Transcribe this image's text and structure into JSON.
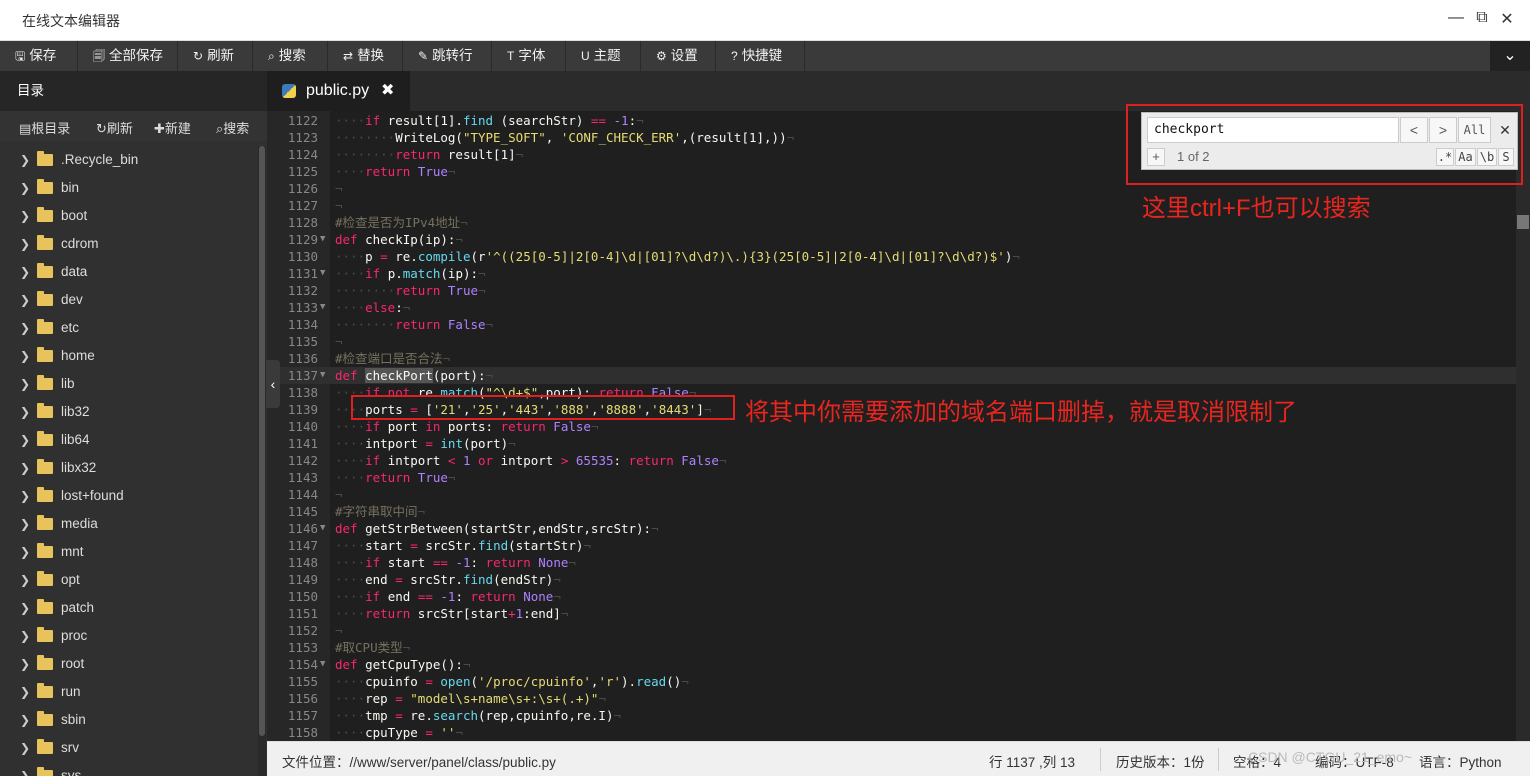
{
  "window": {
    "title": "在线文本编辑器"
  },
  "toolbar": [
    {
      "icon": "save-icon",
      "glyph": "🖫",
      "label": "保存"
    },
    {
      "icon": "save-all-icon",
      "glyph": "🗐",
      "label": "全部保存"
    },
    {
      "icon": "refresh-icon",
      "glyph": "↻",
      "label": "刷新"
    },
    {
      "icon": "search-icon",
      "glyph": "⌕",
      "label": "搜索"
    },
    {
      "icon": "replace-icon",
      "glyph": "⇄",
      "label": "替换"
    },
    {
      "icon": "goto-line-icon",
      "glyph": "✎",
      "label": "跳转行"
    },
    {
      "icon": "font-icon",
      "glyph": "T",
      "label": "字体"
    },
    {
      "icon": "theme-icon",
      "glyph": "U",
      "label": "主题"
    },
    {
      "icon": "settings-icon",
      "glyph": "⚙",
      "label": "设置"
    },
    {
      "icon": "shortcuts-icon",
      "glyph": "?",
      "label": "快捷键"
    }
  ],
  "sidebar": {
    "title": "目录",
    "tools": [
      {
        "icon": "root-dir-icon",
        "glyph": "▤",
        "label": "根目录"
      },
      {
        "icon": "refresh-icon",
        "glyph": "↻",
        "label": "刷新"
      },
      {
        "icon": "new-icon",
        "glyph": "✚",
        "label": "新建"
      },
      {
        "icon": "search-icon",
        "glyph": "⌕",
        "label": "搜索"
      }
    ],
    "tree": [
      ".Recycle_bin",
      "bin",
      "boot",
      "cdrom",
      "data",
      "dev",
      "etc",
      "home",
      "lib",
      "lib32",
      "lib64",
      "libx32",
      "lost+found",
      "media",
      "mnt",
      "opt",
      "patch",
      "proc",
      "root",
      "run",
      "sbin",
      "srv",
      "sys"
    ]
  },
  "tab": {
    "label": "public.py",
    "close": "✖"
  },
  "search": {
    "value": "checkport",
    "prev": "<",
    "next": ">",
    "all": "All",
    "close": "✕",
    "add": "+",
    "count": "1 of 2",
    "options": [
      ".*",
      "Aa",
      "\\b",
      "S"
    ]
  },
  "annotations": {
    "search_note": "这里ctrl+F也可以搜索",
    "ports_note": "将其中你需要添加的域名端口删掉，就是取消限制了"
  },
  "code": {
    "active_line": 1137,
    "lines": [
      {
        "n": 1122,
        "fold": false,
        "indent": 1,
        "tokens": [
          [
            "kw",
            "if"
          ],
          [
            "",
            " result[1]."
          ],
          [
            "fn",
            "find"
          ],
          [
            "",
            " (searchStr) "
          ],
          [
            "kw",
            "=="
          ],
          [
            "",
            " "
          ],
          [
            "cst",
            "-1"
          ],
          [
            "",
            ":"
          ]
        ]
      },
      {
        "n": 1123,
        "fold": false,
        "indent": 2,
        "tokens": [
          [
            "",
            "WriteLog("
          ],
          [
            "str",
            "\"TYPE_SOFT\""
          ],
          [
            "",
            ", "
          ],
          [
            "str",
            "'CONF_CHECK_ERR'"
          ],
          [
            "",
            ",(result[1],))"
          ]
        ]
      },
      {
        "n": 1124,
        "fold": false,
        "indent": 2,
        "tokens": [
          [
            "kw",
            "return"
          ],
          [
            "",
            " result[1]"
          ]
        ]
      },
      {
        "n": 1125,
        "fold": false,
        "indent": 1,
        "tokens": [
          [
            "kw",
            "return"
          ],
          [
            "",
            " "
          ],
          [
            "cst",
            "True"
          ]
        ]
      },
      {
        "n": 1126,
        "fold": false,
        "indent": 0,
        "tokens": []
      },
      {
        "n": 1127,
        "fold": false,
        "indent": 0,
        "tokens": []
      },
      {
        "n": 1128,
        "fold": false,
        "indent": 0,
        "tokens": [
          [
            "cmt",
            "#检查是否为IPv4地址"
          ]
        ]
      },
      {
        "n": 1129,
        "fold": true,
        "indent": 0,
        "tokens": [
          [
            "kw",
            "def"
          ],
          [
            "",
            " checkIp(ip):"
          ]
        ]
      },
      {
        "n": 1130,
        "fold": false,
        "indent": 1,
        "tokens": [
          [
            "",
            "p "
          ],
          [
            "kw",
            "="
          ],
          [
            "",
            " re."
          ],
          [
            "fn",
            "compile"
          ],
          [
            "",
            "(r"
          ],
          [
            "str",
            "'^((25[0-5]|2[0-4]\\d|[01]?\\d\\d?)\\.){3}(25[0-5]|2[0-4]\\d|[01]?\\d\\d?)$'"
          ],
          [
            "",
            ")"
          ]
        ]
      },
      {
        "n": 1131,
        "fold": true,
        "indent": 1,
        "tokens": [
          [
            "kw",
            "if"
          ],
          [
            "",
            " p."
          ],
          [
            "fn",
            "match"
          ],
          [
            "",
            "(ip):"
          ]
        ]
      },
      {
        "n": 1132,
        "fold": false,
        "indent": 2,
        "tokens": [
          [
            "kw",
            "return"
          ],
          [
            "",
            " "
          ],
          [
            "cst",
            "True"
          ]
        ]
      },
      {
        "n": 1133,
        "fold": true,
        "indent": 1,
        "tokens": [
          [
            "kw",
            "else"
          ],
          [
            "",
            ":"
          ]
        ]
      },
      {
        "n": 1134,
        "fold": false,
        "indent": 2,
        "tokens": [
          [
            "kw",
            "return"
          ],
          [
            "",
            " "
          ],
          [
            "cst",
            "False"
          ]
        ]
      },
      {
        "n": 1135,
        "fold": false,
        "indent": 0,
        "tokens": []
      },
      {
        "n": 1136,
        "fold": false,
        "indent": 0,
        "tokens": [
          [
            "cmt",
            "#检查端口是否合法"
          ]
        ]
      },
      {
        "n": 1137,
        "fold": true,
        "indent": 0,
        "tokens": [
          [
            "kw",
            "def"
          ],
          [
            "",
            " "
          ],
          [
            "hl",
            "checkPort"
          ],
          [
            "",
            "(port):"
          ]
        ]
      },
      {
        "n": 1138,
        "fold": false,
        "indent": 1,
        "tokens": [
          [
            "kw",
            "if not"
          ],
          [
            "",
            " re."
          ],
          [
            "fn",
            "match"
          ],
          [
            "",
            "("
          ],
          [
            "str",
            "\"^\\d+$\""
          ],
          [
            "",
            ",port): "
          ],
          [
            "kw",
            "return"
          ],
          [
            "",
            " "
          ],
          [
            "cst",
            "False"
          ]
        ]
      },
      {
        "n": 1139,
        "fold": false,
        "indent": 1,
        "tokens": [
          [
            "",
            "ports "
          ],
          [
            "kw",
            "="
          ],
          [
            "",
            " ["
          ],
          [
            "str",
            "'21'"
          ],
          [
            "",
            ","
          ],
          [
            "str",
            "'25'"
          ],
          [
            "",
            ","
          ],
          [
            "str",
            "'443'"
          ],
          [
            "",
            ","
          ],
          [
            "str",
            "'888'"
          ],
          [
            "",
            ","
          ],
          [
            "str",
            "'8888'"
          ],
          [
            "",
            ","
          ],
          [
            "str",
            "'8443'"
          ],
          [
            "",
            "]"
          ]
        ]
      },
      {
        "n": 1140,
        "fold": false,
        "indent": 1,
        "tokens": [
          [
            "kw",
            "if"
          ],
          [
            "",
            " port "
          ],
          [
            "kw",
            "in"
          ],
          [
            "",
            " ports: "
          ],
          [
            "kw",
            "return"
          ],
          [
            "",
            " "
          ],
          [
            "cst",
            "False"
          ]
        ]
      },
      {
        "n": 1141,
        "fold": false,
        "indent": 1,
        "tokens": [
          [
            "",
            "intport "
          ],
          [
            "kw",
            "="
          ],
          [
            "",
            " "
          ],
          [
            "fn",
            "int"
          ],
          [
            "",
            "(port)"
          ]
        ]
      },
      {
        "n": 1142,
        "fold": false,
        "indent": 1,
        "tokens": [
          [
            "kw",
            "if"
          ],
          [
            "",
            " intport "
          ],
          [
            "kw",
            "<"
          ],
          [
            "",
            " "
          ],
          [
            "cst",
            "1"
          ],
          [
            "",
            " "
          ],
          [
            "kw",
            "or"
          ],
          [
            "",
            " intport "
          ],
          [
            "kw",
            ">"
          ],
          [
            "",
            " "
          ],
          [
            "cst",
            "65535"
          ],
          [
            "",
            ": "
          ],
          [
            "kw",
            "return"
          ],
          [
            "",
            " "
          ],
          [
            "cst",
            "False"
          ]
        ]
      },
      {
        "n": 1143,
        "fold": false,
        "indent": 1,
        "tokens": [
          [
            "kw",
            "return"
          ],
          [
            "",
            " "
          ],
          [
            "cst",
            "True"
          ]
        ]
      },
      {
        "n": 1144,
        "fold": false,
        "indent": 0,
        "tokens": []
      },
      {
        "n": 1145,
        "fold": false,
        "indent": 0,
        "tokens": [
          [
            "cmt",
            "#字符串取中间"
          ]
        ]
      },
      {
        "n": 1146,
        "fold": true,
        "indent": 0,
        "tokens": [
          [
            "kw",
            "def"
          ],
          [
            "",
            " getStrBetween(startStr,endStr,srcStr):"
          ]
        ]
      },
      {
        "n": 1147,
        "fold": false,
        "indent": 1,
        "tokens": [
          [
            "",
            "start "
          ],
          [
            "kw",
            "="
          ],
          [
            "",
            " srcStr."
          ],
          [
            "fn",
            "find"
          ],
          [
            "",
            "(startStr)"
          ]
        ]
      },
      {
        "n": 1148,
        "fold": false,
        "indent": 1,
        "tokens": [
          [
            "kw",
            "if"
          ],
          [
            "",
            " start "
          ],
          [
            "kw",
            "=="
          ],
          [
            "",
            " "
          ],
          [
            "cst",
            "-1"
          ],
          [
            "",
            ": "
          ],
          [
            "kw",
            "return"
          ],
          [
            "",
            " "
          ],
          [
            "cst",
            "None"
          ]
        ]
      },
      {
        "n": 1149,
        "fold": false,
        "indent": 1,
        "tokens": [
          [
            "",
            "end "
          ],
          [
            "kw",
            "="
          ],
          [
            "",
            " srcStr."
          ],
          [
            "fn",
            "find"
          ],
          [
            "",
            "(endStr)"
          ]
        ]
      },
      {
        "n": 1150,
        "fold": false,
        "indent": 1,
        "tokens": [
          [
            "kw",
            "if"
          ],
          [
            "",
            " end "
          ],
          [
            "kw",
            "=="
          ],
          [
            "",
            " "
          ],
          [
            "cst",
            "-1"
          ],
          [
            "",
            ": "
          ],
          [
            "kw",
            "return"
          ],
          [
            "",
            " "
          ],
          [
            "cst",
            "None"
          ]
        ]
      },
      {
        "n": 1151,
        "fold": false,
        "indent": 1,
        "tokens": [
          [
            "kw",
            "return"
          ],
          [
            "",
            " srcStr[start"
          ],
          [
            "kw",
            "+"
          ],
          [
            "cst",
            "1"
          ],
          [
            "",
            ":end]"
          ]
        ]
      },
      {
        "n": 1152,
        "fold": false,
        "indent": 0,
        "tokens": []
      },
      {
        "n": 1153,
        "fold": false,
        "indent": 0,
        "tokens": [
          [
            "cmt",
            "#取CPU类型"
          ]
        ]
      },
      {
        "n": 1154,
        "fold": true,
        "indent": 0,
        "tokens": [
          [
            "kw",
            "def"
          ],
          [
            "",
            " getCpuType():"
          ]
        ]
      },
      {
        "n": 1155,
        "fold": false,
        "indent": 1,
        "tokens": [
          [
            "",
            "cpuinfo "
          ],
          [
            "kw",
            "="
          ],
          [
            "",
            " "
          ],
          [
            "fn",
            "open"
          ],
          [
            "",
            "("
          ],
          [
            "str",
            "'/proc/cpuinfo'"
          ],
          [
            "",
            ","
          ],
          [
            "str",
            "'r'"
          ],
          [
            "",
            ")."
          ],
          [
            "fn",
            "read"
          ],
          [
            "",
            "()"
          ]
        ]
      },
      {
        "n": 1156,
        "fold": false,
        "indent": 1,
        "tokens": [
          [
            "",
            "rep "
          ],
          [
            "kw",
            "="
          ],
          [
            "",
            " "
          ],
          [
            "str",
            "\"model\\s+name\\s+:\\s+(.+)\""
          ]
        ]
      },
      {
        "n": 1157,
        "fold": false,
        "indent": 1,
        "tokens": [
          [
            "",
            "tmp "
          ],
          [
            "kw",
            "="
          ],
          [
            "",
            " re."
          ],
          [
            "fn",
            "search"
          ],
          [
            "",
            "(rep,cpuinfo,re.I)"
          ]
        ]
      },
      {
        "n": 1158,
        "fold": false,
        "indent": 1,
        "tokens": [
          [
            "",
            "cpuType "
          ],
          [
            "kw",
            "="
          ],
          [
            "",
            " "
          ],
          [
            "str",
            "''"
          ]
        ]
      }
    ]
  },
  "status": {
    "path": "文件位置：//www/server/panel/class/public.py",
    "position": "行 1137 ,列 13",
    "history": "历史版本：1份",
    "indent": "空格：4",
    "encoding": "编码：UTF-8",
    "language": "语言：Python"
  },
  "watermark": "CSDN @CTGU_21_emo~"
}
